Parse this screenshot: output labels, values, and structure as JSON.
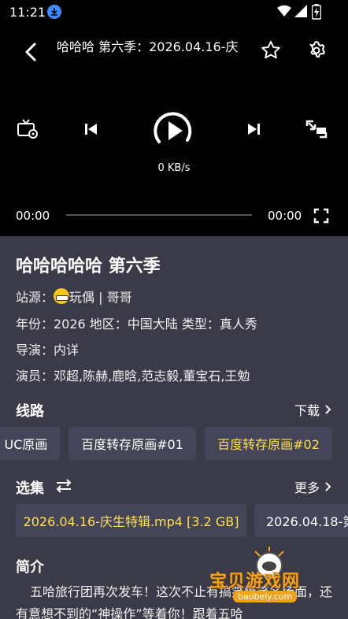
{
  "status_bar": {
    "time": "11:21"
  },
  "player": {
    "title": "哈哈哈 第六季：2026.04.16-庆",
    "speed": "0 KB/s",
    "current_time": "00:00",
    "total_time": "00:00",
    "progress": 0
  },
  "details": {
    "title": "哈哈哈哈哈 第六季",
    "source_label": "站源：",
    "source_name": "玩偶",
    "source_sep": " | ",
    "source_extra": "哥哥",
    "meta": "年份：2026  地区：中国大陆  类型：真人秀",
    "director": "导演：内详",
    "actors": "演员：邓超,陈赫,鹿晗,范志毅,董宝石,王勉"
  },
  "lines_section": {
    "title": "线路",
    "more": "下载",
    "chips": [
      {
        "label": "UC原画",
        "active": false
      },
      {
        "label": "百度转存原画#01",
        "active": false
      },
      {
        "label": "百度转存原画#02",
        "active": true
      }
    ]
  },
  "episodes_section": {
    "title": "选集",
    "more": "更多",
    "chips": [
      {
        "label": "2026.04.16-庆生特辑.mp4 [3.2 GB]",
        "active": true
      },
      {
        "label": "2026.04.18-第",
        "active": false
      }
    ]
  },
  "intro_section": {
    "title": "简介",
    "text": "五哈旅行团再次发车！这次不止有搞笑爆笑名场面，还有意想不到的“神操作”等着你！跟着五哈"
  },
  "watermark": {
    "text": "宝贝游戏网",
    "url": "baobeiy.com"
  },
  "colors": {
    "accent": "#ffe14a",
    "panel": "#3a3a48",
    "chip": "#45455a"
  }
}
